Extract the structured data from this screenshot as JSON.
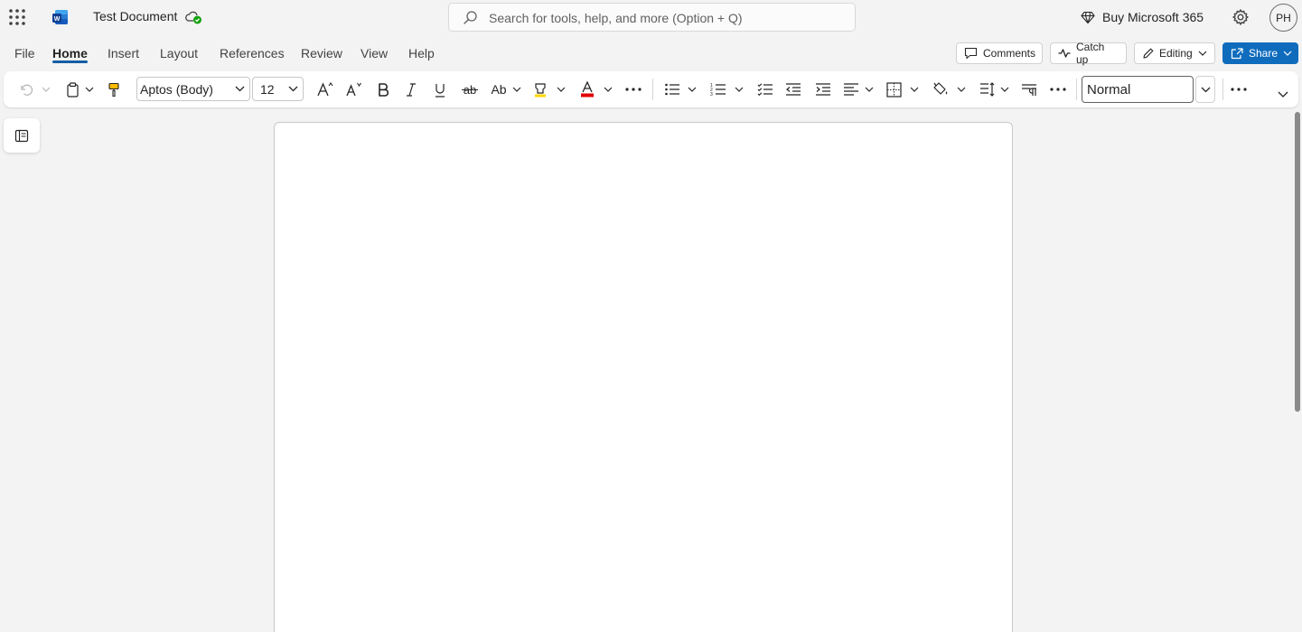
{
  "app": {
    "doc_title": "Test Document",
    "search_placeholder": "Search for tools, help, and more (Option + Q)",
    "buy_label": "Buy Microsoft 365",
    "avatar_initials": "PH",
    "accent_color": "#0f6cbd"
  },
  "tabs": [
    {
      "label": "File"
    },
    {
      "label": "Home",
      "active": true
    },
    {
      "label": "Insert"
    },
    {
      "label": "Layout"
    },
    {
      "label": "References"
    },
    {
      "label": "Review"
    },
    {
      "label": "View"
    },
    {
      "label": "Help"
    }
  ],
  "header_buttons": {
    "comments": "Comments",
    "catchup": "Catch up",
    "editing": "Editing",
    "share": "Share"
  },
  "ribbon": {
    "font_name": "Aptos (Body)",
    "font_size": "12",
    "style": "Normal",
    "icons": [
      "undo-icon",
      "clipboard-icon",
      "format-painter-icon",
      "grow-font-icon",
      "shrink-font-icon",
      "bold-icon",
      "italic-icon",
      "underline-icon",
      "strikethrough-icon",
      "text-effects-icon",
      "highlight-icon",
      "font-color-icon",
      "more-icon",
      "bullets-icon",
      "numbering-icon",
      "checklist-icon",
      "decrease-indent-icon",
      "increase-indent-icon",
      "align-icon",
      "borders-icon",
      "shading-icon",
      "line-spacing-icon",
      "paragraph-marks-icon"
    ],
    "highlight_color": "#ffd800",
    "font_color": "#e00000"
  }
}
